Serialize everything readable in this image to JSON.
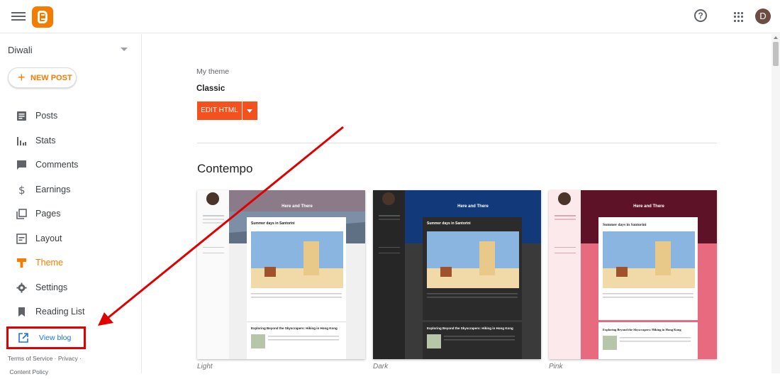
{
  "header": {
    "avatar_initial": "D"
  },
  "sidebar": {
    "blog_name": "Diwali",
    "new_post_label": "NEW POST",
    "items": [
      {
        "label": "Posts",
        "icon": "posts-icon"
      },
      {
        "label": "Stats",
        "icon": "stats-icon"
      },
      {
        "label": "Comments",
        "icon": "comments-icon"
      },
      {
        "label": "Earnings",
        "icon": "earnings-icon"
      },
      {
        "label": "Pages",
        "icon": "pages-icon"
      },
      {
        "label": "Layout",
        "icon": "layout-icon"
      },
      {
        "label": "Theme",
        "icon": "theme-icon",
        "active": true
      },
      {
        "label": "Settings",
        "icon": "settings-icon"
      },
      {
        "label": "Reading List",
        "icon": "reading-list-icon"
      }
    ],
    "view_blog_label": "View blog",
    "footer": {
      "terms": "Terms of Service",
      "privacy": "Privacy",
      "content_policy": "Content Policy"
    }
  },
  "main": {
    "my_theme_label": "My theme",
    "current_theme": "Classic",
    "edit_html_label": "EDIT HTML",
    "section_title": "Contempo",
    "themes": [
      {
        "caption": "Light",
        "blog_title": "Here and There",
        "post_title": "Summer days in Santorini",
        "post2_title": "Exploring Beyond the Skyscrapers: Hiking in Hong Kong"
      },
      {
        "caption": "Dark",
        "blog_title": "Here and There",
        "post_title": "Summer days in Santorini",
        "post2_title": "Exploring Beyond the Skyscrapers: Hiking in Hong Kong"
      },
      {
        "caption": "Pink",
        "blog_title": "Here and There",
        "post_title": "Summer days in Santorini",
        "post2_title": "Exploring Beyond the Skyscrapers: Hiking in Hong Kong"
      }
    ]
  },
  "colors": {
    "accent": "#f57c00",
    "edit_button": "#f4511e",
    "annotation": "#e00000",
    "link": "#1a73e8"
  }
}
